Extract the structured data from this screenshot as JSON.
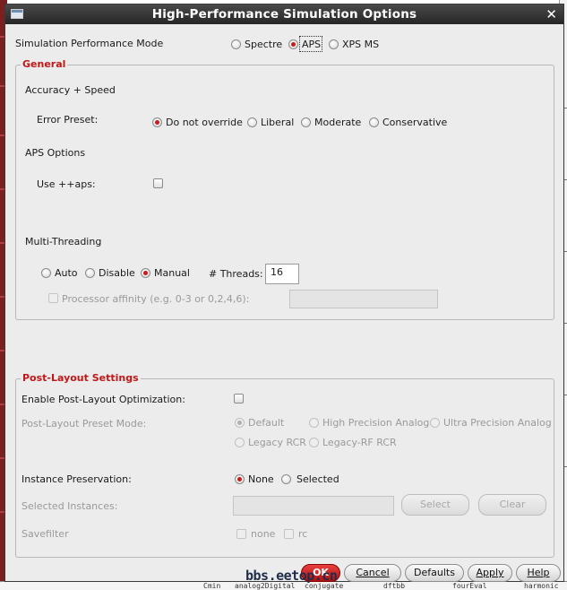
{
  "window": {
    "title": "High-Performance Simulation Options",
    "close_glyph": "✕"
  },
  "perf_mode": {
    "label": "Simulation Performance Mode",
    "options": [
      "Spectre",
      "APS",
      "XPS MS"
    ],
    "selected": "APS"
  },
  "general": {
    "title": "General",
    "accuracy_label": "Accuracy + Speed",
    "error_preset_label": "Error Preset:",
    "error_preset_options": [
      "Do not override",
      "Liberal",
      "Moderate",
      "Conservative"
    ],
    "error_preset_selected": "Do not override",
    "aps_options_label": "APS Options",
    "use_aps_label": "Use ++aps:",
    "use_aps_checked": false,
    "multithreading_label": "Multi-Threading",
    "threading_options": [
      "Auto",
      "Disable",
      "Manual"
    ],
    "threading_selected": "Manual",
    "threads_label": "# Threads:",
    "threads_value": "16",
    "processor_affinity_label": "Processor affinity (e.g. 0-3 or 0,2,4,6):",
    "processor_affinity_value": ""
  },
  "post_layout": {
    "title": "Post-Layout Settings",
    "enable_label": "Enable Post-Layout Optimization:",
    "enable_checked": false,
    "preset_mode_label": "Post-Layout Preset Mode:",
    "preset_options": [
      "Default",
      "High Precision Analog",
      "Ultra Precision Analog",
      "Legacy RCR",
      "Legacy-RF RCR"
    ],
    "preset_selected": "Default",
    "instance_preservation_label": "Instance Preservation:",
    "instance_options": [
      "None",
      "Selected"
    ],
    "instance_selected": "None",
    "selected_instances_label": "Selected Instances:",
    "selected_instances_value": "",
    "select_button": "Select",
    "clear_button": "Clear",
    "savefilter_label": "Savefilter",
    "savefilter_options": [
      "none",
      "rc"
    ]
  },
  "footer": {
    "ok": "OK",
    "cancel": "Cancel",
    "defaults": "Defaults",
    "apply": "Apply",
    "help": "Help"
  },
  "watermark": "bbs.eetop.cn",
  "background_text": {
    "bottom": [
      "Cmin",
      "analog2Digital",
      "conjugate",
      "dftbb",
      "fourEval",
      "harmonic"
    ]
  },
  "colors": {
    "accent": "#d01818",
    "titlebar": "#2e2e2e",
    "dialog_bg": "#ececec"
  }
}
